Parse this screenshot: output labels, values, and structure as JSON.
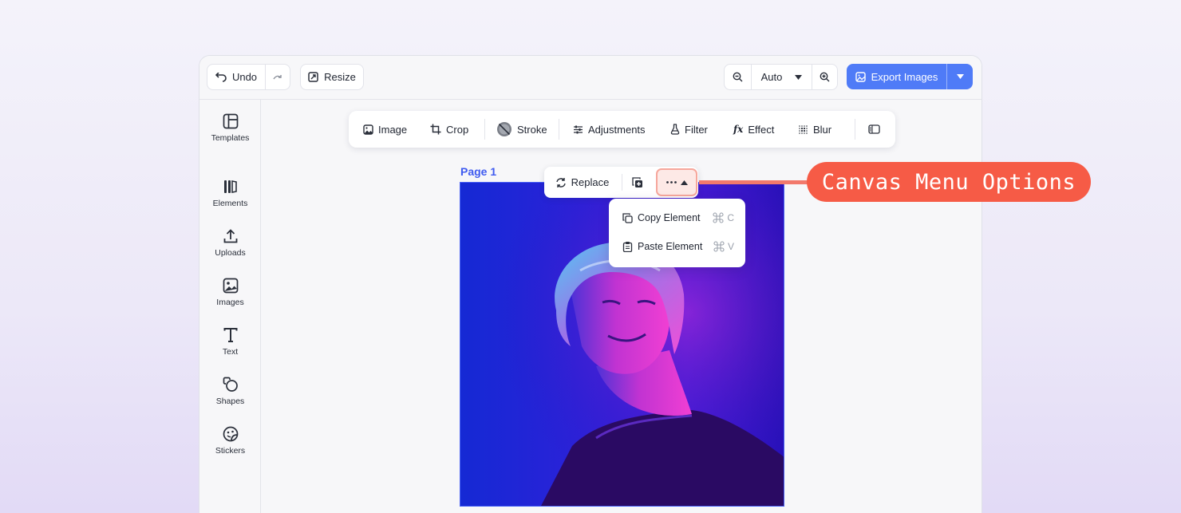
{
  "topbar": {
    "undo_label": "Undo",
    "resize_label": "Resize",
    "zoom_value": "Auto",
    "export_label": "Export Images"
  },
  "sidebar": {
    "items": [
      {
        "label": "Templates",
        "icon": "templates-icon"
      },
      {
        "label": "Elements",
        "icon": "elements-icon"
      },
      {
        "label": "Uploads",
        "icon": "upload-icon"
      },
      {
        "label": "Images",
        "icon": "image-icon"
      },
      {
        "label": "Text",
        "icon": "text-icon"
      },
      {
        "label": "Shapes",
        "icon": "shapes-icon"
      },
      {
        "label": "Stickers",
        "icon": "sticker-icon"
      }
    ]
  },
  "toolbar": {
    "image": "Image",
    "crop": "Crop",
    "stroke": "Stroke",
    "adjustments": "Adjustments",
    "filter": "Filter",
    "effect": "Effect",
    "blur": "Blur"
  },
  "canvas": {
    "page_label": "Page 1",
    "replace_label": "Replace"
  },
  "menu": {
    "items": [
      {
        "label": "Copy Element",
        "shortcut_key": "C"
      },
      {
        "label": "Paste Element",
        "shortcut_key": "V"
      }
    ]
  },
  "callout": {
    "text": "Canvas Menu Options"
  },
  "colors": {
    "accent": "#4f7bf7",
    "callout": "#f65b46",
    "page_label": "#3f5bf0"
  }
}
